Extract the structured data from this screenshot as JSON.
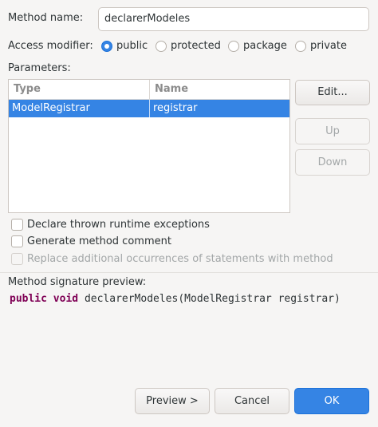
{
  "method_name": {
    "label": "Method name:",
    "value": "declarerModeles"
  },
  "access": {
    "label": "Access modifier:",
    "options": [
      "public",
      "protected",
      "package",
      "private"
    ],
    "selected": "public"
  },
  "parameters": {
    "label": "Parameters:",
    "columns": [
      "Type",
      "Name"
    ],
    "rows": [
      {
        "type": "ModelRegistrar",
        "name": "registrar"
      }
    ]
  },
  "side_buttons": {
    "edit": "Edit...",
    "up": "Up",
    "down": "Down"
  },
  "options": {
    "declare_exceptions": "Declare thrown runtime exceptions",
    "generate_comment": "Generate method comment",
    "replace_occurrences": "Replace additional occurrences of statements with method"
  },
  "preview": {
    "label": "Method signature preview:",
    "kw_public": "public",
    "kw_void": "void",
    "signature_rest": "declarerModeles(ModelRegistrar registrar)"
  },
  "footer": {
    "preview": "Preview >",
    "cancel": "Cancel",
    "ok": "OK"
  },
  "colors": {
    "accent": "#3584e4",
    "keyword": "#7f0055"
  }
}
